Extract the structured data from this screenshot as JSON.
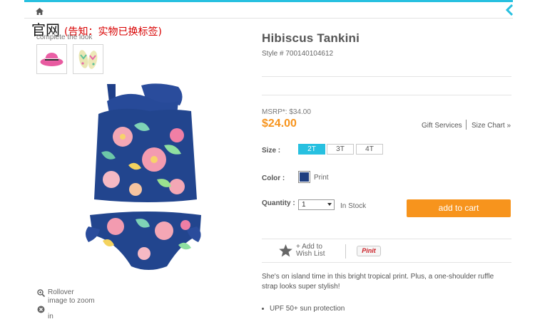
{
  "watermark": {
    "main": "官网",
    "note": "(告知：实物已换标签)"
  },
  "complete_look": "complete the look",
  "zoom_hint": {
    "line1": "Rollover",
    "line2": "image to zoom",
    "line3": "in"
  },
  "product": {
    "title": "Hibiscus Tankini",
    "style": "Style # 700140104612",
    "msrp": "MSRP*: $34.00",
    "price": "$24.00",
    "gift_services": "Gift Services",
    "size_chart": "Size Chart »",
    "size_label": "Size :",
    "sizes": [
      "2T",
      "3T",
      "4T"
    ],
    "selected_size": "2T",
    "color_label": "Color :",
    "color_name": "Print",
    "swatch_color": "#1f3f80",
    "quantity_label": "Quantity :",
    "quantity_value": "1",
    "stock": "In Stock",
    "add_to_cart": "add to cart",
    "wishlist_line1": "+ Add to",
    "wishlist_line2": "Wish List",
    "pin_it": "Pinit",
    "description": "She's on island time in this bright tropical print. Plus, a one-shoulder ruffle strap looks super stylish!",
    "features": [
      "UPF 50+ sun protection"
    ]
  },
  "colors": {
    "accent_blue": "#27c0e0",
    "cart_orange": "#f7941d",
    "price_orange": "#f7941d"
  }
}
